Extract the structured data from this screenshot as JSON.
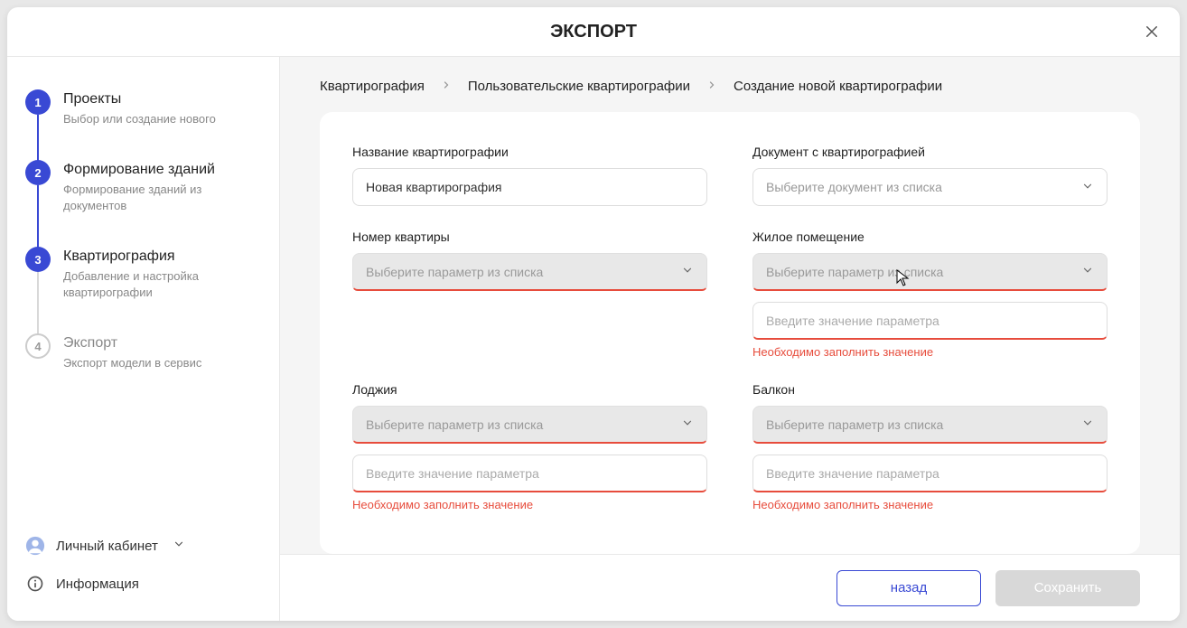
{
  "header": {
    "title": "ЭКСПОРТ"
  },
  "steps": [
    {
      "num": "1",
      "title": "Проекты",
      "desc": "Выбор или создание нового"
    },
    {
      "num": "2",
      "title": "Формирование зданий",
      "desc": "Формирование зданий из документов"
    },
    {
      "num": "3",
      "title": "Квартирография",
      "desc": "Добавление и настройка квартирографии"
    },
    {
      "num": "4",
      "title": "Экспорт",
      "desc": "Экспорт модели в сервис"
    }
  ],
  "sidebar_bottom": {
    "account_label": "Личный кабинет",
    "info_label": "Информация"
  },
  "breadcrumb": {
    "items": [
      "Квартирография",
      "Пользовательские квартирографии",
      "Создание новой квартирографии"
    ]
  },
  "form": {
    "name_label": "Название квартирографии",
    "name_value": "Новая квартирография",
    "doc_label": "Документ с квартирографией",
    "doc_placeholder": "Выберите документ из списка",
    "apt_num_label": "Номер квартиры",
    "apt_num_placeholder": "Выберите параметр из списка",
    "living_label": "Жилое помещение",
    "living_placeholder": "Выберите параметр из списка",
    "living_value_placeholder": "Введите значение параметра",
    "living_error": "Необходимо заполнить значение",
    "loggia_label": "Лоджия",
    "loggia_placeholder": "Выберите параметр из списка",
    "loggia_value_placeholder": "Введите значение параметра",
    "loggia_error": "Необходимо заполнить значение",
    "balcony_label": "Балкон",
    "balcony_placeholder": "Выберите параметр из списка",
    "balcony_value_placeholder": "Введите значение параметра",
    "balcony_error": "Необходимо заполнить значение"
  },
  "footer": {
    "back_label": "назад",
    "save_label": "Сохранить"
  }
}
